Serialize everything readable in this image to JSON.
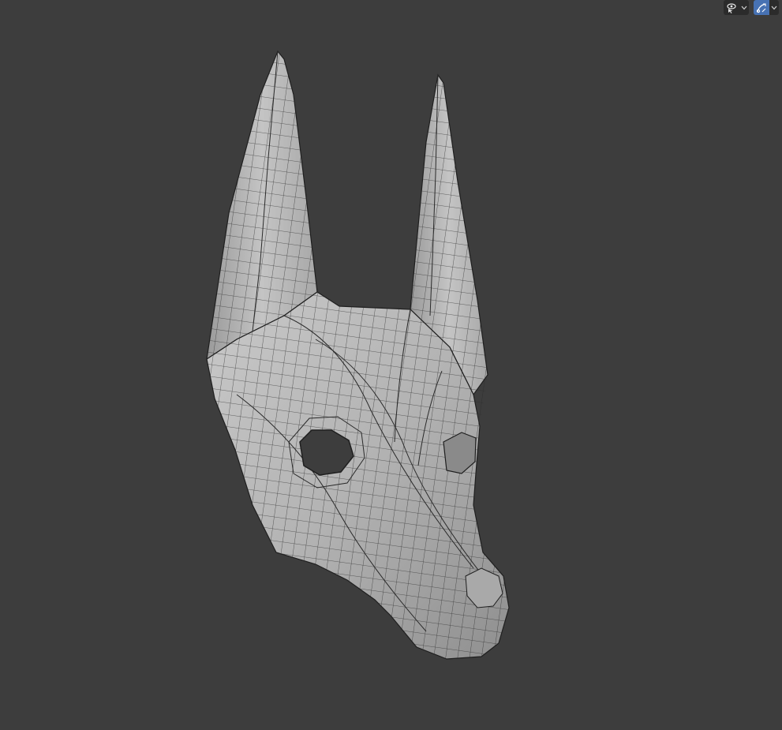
{
  "viewport": {
    "background": "#3d3d3d",
    "object": "anubis-mask-wireframe-mesh"
  },
  "header": {
    "visibility_tool": {
      "icon": "eye-selectability-icon",
      "dropdown_icon": "chevron-down-icon"
    },
    "gizmo_tool": {
      "icon": "gizmo-toggle-icon",
      "active": true,
      "dropdown_icon": "chevron-down-icon"
    }
  },
  "colors": {
    "mesh_fill": "#b5b5b5",
    "mesh_shadow": "#8e8e8e",
    "mesh_highlight": "#cfcfcf",
    "wire": "#2a2a2a",
    "active_button": "#4772b3"
  }
}
